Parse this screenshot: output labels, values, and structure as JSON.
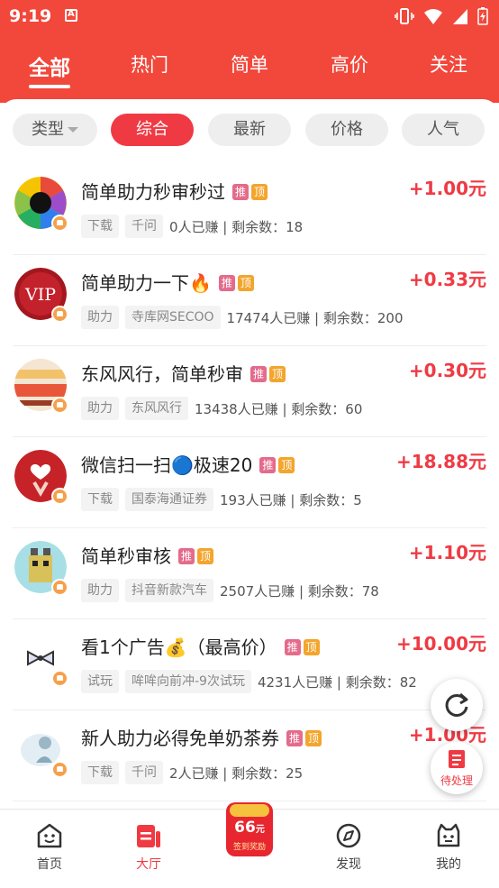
{
  "status_bar": {
    "time": "9:19"
  },
  "top_tabs": [
    {
      "label": "全部",
      "active": true
    },
    {
      "label": "热门",
      "active": false
    },
    {
      "label": "简单",
      "active": false
    },
    {
      "label": "高价",
      "active": false
    },
    {
      "label": "关注",
      "active": false
    }
  ],
  "filters": {
    "type_label": "类型",
    "chips": [
      "综合",
      "最新",
      "价格",
      "人气"
    ],
    "active_chip": "综合"
  },
  "badges": {
    "tui": "推",
    "ding": "顶"
  },
  "tasks": [
    {
      "title": "简单助力秒审秒过",
      "emoji": "",
      "price": "+1.00元",
      "category": "下载",
      "app": "千问",
      "stats": "0人已赚 | 剩余数：18",
      "avatar": "aperture"
    },
    {
      "title": "简单助力一下",
      "emoji": "🔥",
      "price": "+0.33元",
      "category": "助力",
      "app": "寺库网SECOO",
      "stats": "17474人已赚 | 剩余数：200",
      "avatar": "vip"
    },
    {
      "title": "东风风行，简单秒审",
      "emoji": "",
      "price": "+0.30元",
      "category": "助力",
      "app": "东风风行",
      "stats": "13438人已赚 | 剩余数：60",
      "avatar": "car"
    },
    {
      "title": "微信扫一扫",
      "emoji": "🔵",
      "title_suffix": "极速20",
      "price": "+18.88元",
      "category": "下载",
      "app": "国泰海通证券",
      "stats": "193人已赚 | 剩余数：5",
      "avatar": "heart"
    },
    {
      "title": "简单秒审核",
      "emoji": "",
      "price": "+1.10元",
      "category": "助力",
      "app": "抖音新款汽车",
      "stats": "2507人已赚 | 剩余数：78",
      "avatar": "robot"
    },
    {
      "title": "看1个广告",
      "emoji": "💰",
      "title_suffix": "（最高价）",
      "price": "+10.00元",
      "category": "试玩",
      "app": "哞哞向前冲-9次试玩",
      "stats": "4231人已赚 | 剩余数：82",
      "avatar": "bow"
    },
    {
      "title": "新人助力必得免单奶茶券",
      "emoji": "",
      "price": "+1.00元",
      "category": "下载",
      "app": "千问",
      "stats": "2人已赚 | 剩余数：25",
      "avatar": "cloud"
    }
  ],
  "floating": {
    "todo_label": "待处理"
  },
  "bottom_nav": [
    {
      "label": "首页",
      "icon": "smile-home-icon",
      "active": false
    },
    {
      "label": "大厅",
      "icon": "hall-icon",
      "active": true
    },
    {
      "label": "发现",
      "icon": "compass-icon",
      "active": false
    },
    {
      "label": "我的",
      "icon": "cat-profile-icon",
      "active": false
    }
  ],
  "promo": {
    "amount": "66",
    "unit": "元",
    "caption": "签到奖励"
  },
  "colors": {
    "brand_red": "#f2473b",
    "price_red": "#ef3a44",
    "tag_tui": "#e46b8b",
    "tag_ding": "#f3a52d"
  }
}
